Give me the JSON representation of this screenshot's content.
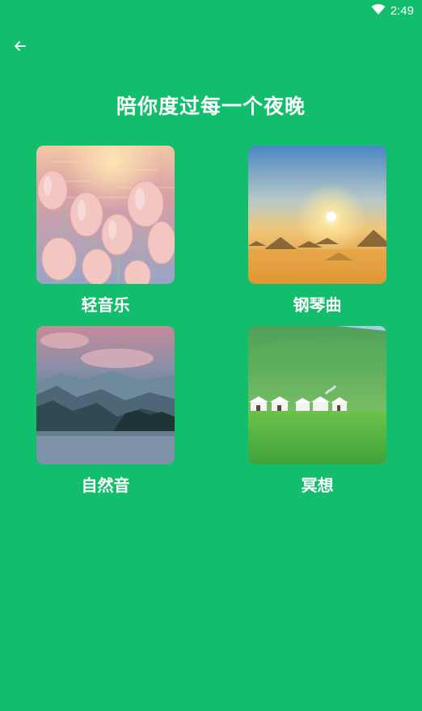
{
  "status_bar": {
    "time": "2:49",
    "icons": [
      "wifi-icon"
    ]
  },
  "header": {
    "back_icon": "arrow-left-icon",
    "title": "陪你度过每一个夜晚"
  },
  "categories": [
    {
      "label": "轻音乐",
      "image": "pink-tulips-over-water"
    },
    {
      "label": "钢琴曲",
      "image": "sunrise-over-misty-mountains"
    },
    {
      "label": "自然音",
      "image": "lake-with-mountains-at-dusk"
    },
    {
      "label": "冥想",
      "image": "yurts-on-green-grassland"
    }
  ],
  "colors": {
    "background": "#12bd6c",
    "text": "#ffffff"
  }
}
